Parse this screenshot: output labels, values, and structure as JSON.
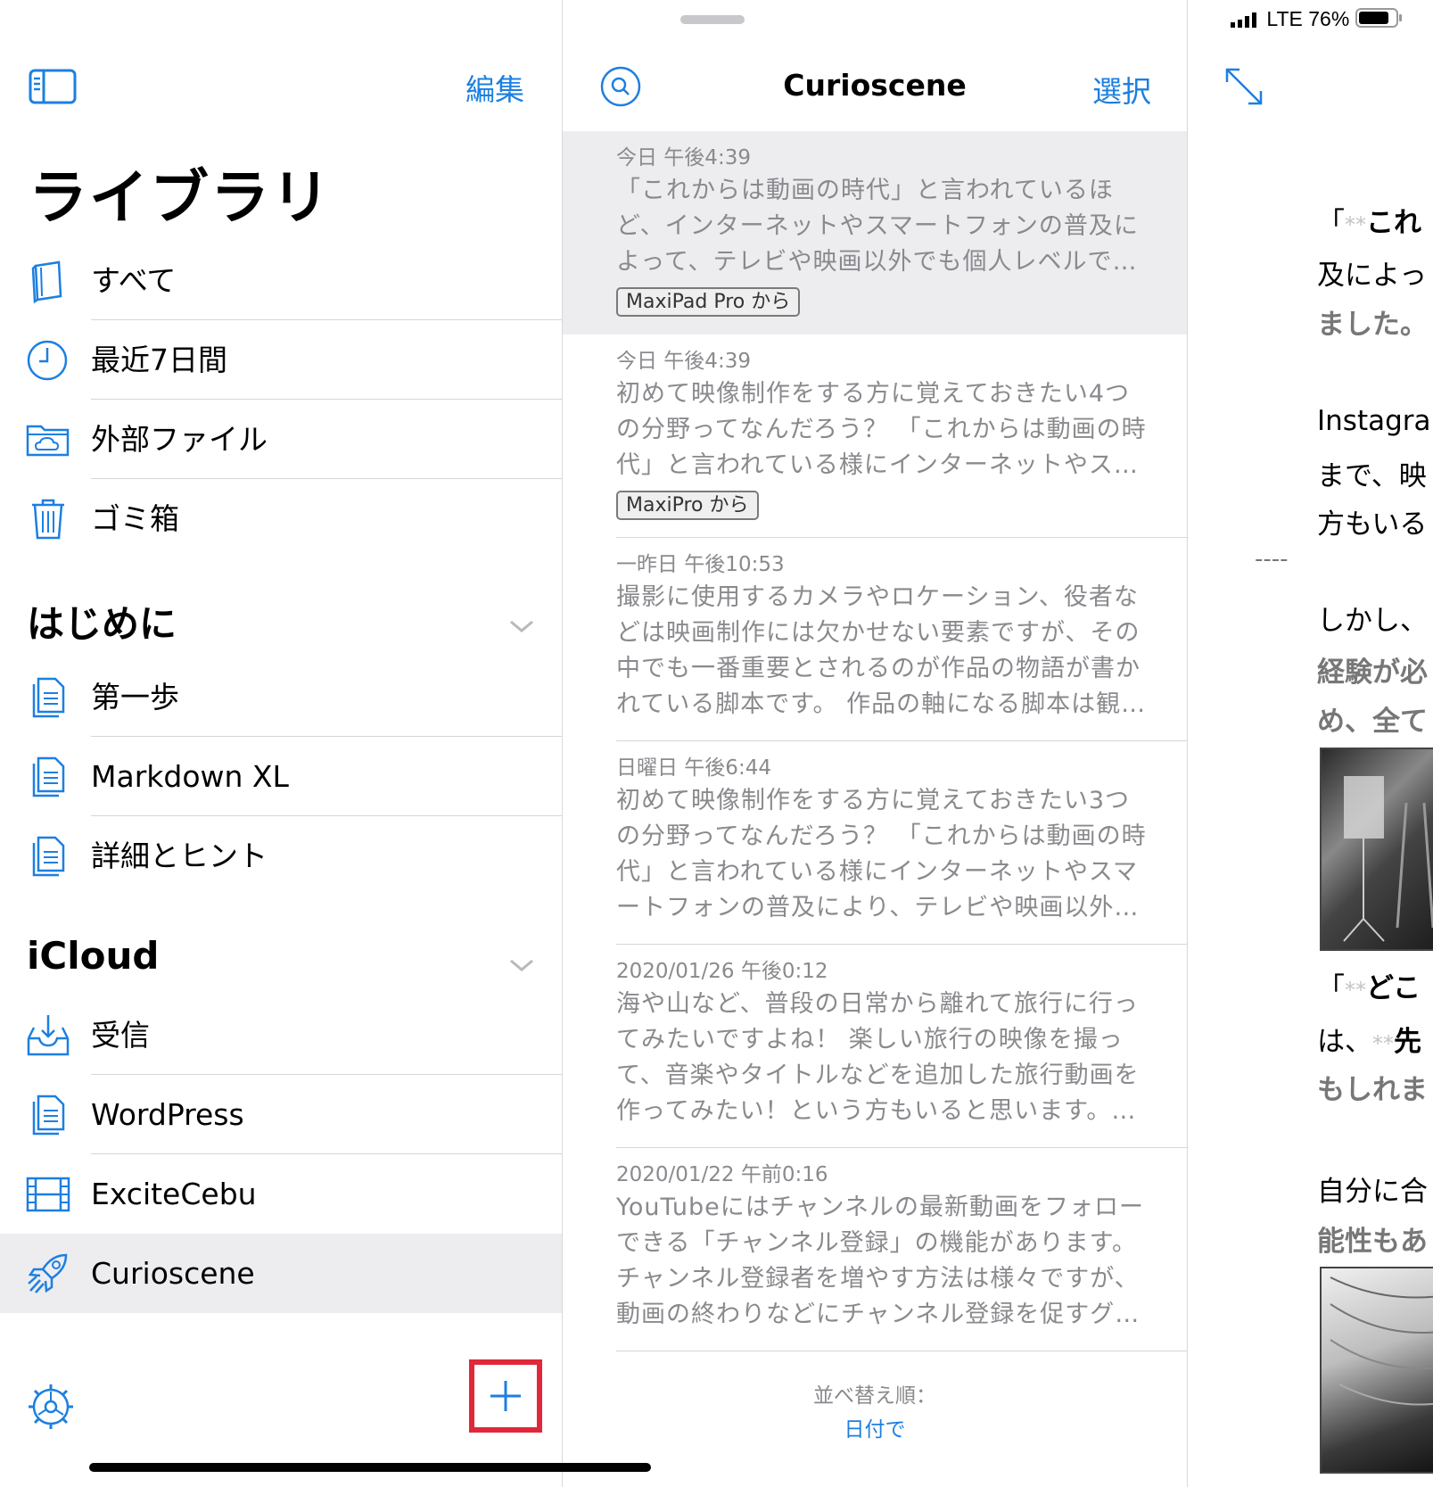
{
  "sidebar": {
    "edit_label": "編集",
    "title": "ライブラリ",
    "library_items": [
      {
        "label": "すべて",
        "icon": "book-icon"
      },
      {
        "label": "最近7日間",
        "icon": "clock-icon"
      },
      {
        "label": "外部ファイル",
        "icon": "cloud-folder-icon"
      },
      {
        "label": "ゴミ箱",
        "icon": "trash-icon"
      }
    ],
    "sections": [
      {
        "title": "はじめに",
        "items": [
          {
            "label": "第一歩",
            "icon": "document-icon"
          },
          {
            "label": "Markdown XL",
            "icon": "document-icon"
          },
          {
            "label": "詳細とヒント",
            "icon": "document-icon"
          }
        ]
      },
      {
        "title": "iCloud",
        "items": [
          {
            "label": "受信",
            "icon": "inbox-icon"
          },
          {
            "label": "WordPress",
            "icon": "document-icon"
          },
          {
            "label": "ExciteCebu",
            "icon": "film-icon"
          },
          {
            "label": "Curioscene",
            "icon": "rocket-icon",
            "selected": true
          }
        ]
      }
    ]
  },
  "middle": {
    "title": "Curioscene",
    "select_label": "選択",
    "notes": [
      {
        "date": "今日 午後4:39",
        "text": "「これからは動画の時代」と言われているほど、インターネットやスマートフォンの普及によって、テレビや映画以外でも個人レベルで…",
        "tag": "MaxiPad Pro から",
        "active": true
      },
      {
        "date": "今日 午後4:39",
        "text": "初めて映像制作をする方に覚えておきたい4つの分野ってなんだろう？ 「これからは動画の時代」と言われている様にインターネットやス…",
        "tag": "MaxiPro から"
      },
      {
        "date": "一昨日 午後10:53",
        "text": "撮影に使用するカメラやロケーション、役者などは映画制作には欠かせない要素ですが、その中でも一番重要とされるのが作品の物語が書かれている脚本です。 作品の軸になる脚本は観…"
      },
      {
        "date": "日曜日 午後6:44",
        "text": "初めて映像制作をする方に覚えておきたい3つの分野ってなんだろう？ 「これからは動画の時代」と言われている様にインターネットやスマートフォンの普及により、テレビや映画以外…"
      },
      {
        "date": "2020/01/26 午後0:12",
        "text": "海や山など、普段の日常から離れて旅行に行ってみたいですよね！ 楽しい旅行の映像を撮って、音楽やタイトルなどを追加した旅行動画を作ってみたい！という方もいると思います。…"
      },
      {
        "date": "2020/01/22 午前0:16",
        "text": "YouTubeにはチャンネルの最新動画をフォローできる「チャンネル登録」の機能があります。チャンネル登録者を増やす方法は様々ですが、動画の終わりなどにチャンネル登録を促すグ…"
      }
    ],
    "sort_label": "並べ替え順：",
    "sort_value": "日付で"
  },
  "status_bar": {
    "network": "LTE",
    "battery": "76%"
  },
  "editor": {
    "lines": [
      {
        "prefix": "「",
        "marker": "**",
        "text": "これ"
      },
      {
        "text": "及によっ"
      },
      {
        "text": "ました。"
      },
      {
        "text": "Instagrar"
      },
      {
        "text": "まで、映"
      },
      {
        "text": "方もいる"
      },
      {
        "text": "----"
      },
      {
        "text": "しかし、"
      },
      {
        "text": "経験が必"
      },
      {
        "text": "め、全て"
      },
      {
        "prefix": "「",
        "marker": "**",
        "text": "どこ"
      },
      {
        "prefix": "は、",
        "marker": "**",
        "text": "先"
      },
      {
        "text": "もしれま"
      },
      {
        "text": "自分に合"
      },
      {
        "text": "能性もあ"
      }
    ]
  },
  "colors": {
    "accent": "#1d7fe0",
    "highlight": "#e0283a",
    "selected_bg": "#ededf0"
  }
}
